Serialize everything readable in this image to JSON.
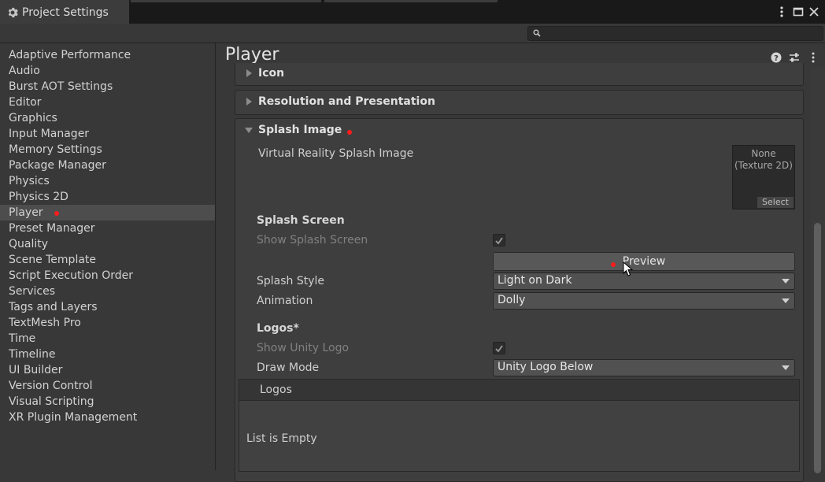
{
  "window": {
    "title": "Project Settings"
  },
  "sidebar": {
    "items": [
      {
        "label": "Adaptive Performance"
      },
      {
        "label": "Audio"
      },
      {
        "label": "Burst AOT Settings"
      },
      {
        "label": "Editor"
      },
      {
        "label": "Graphics"
      },
      {
        "label": "Input Manager"
      },
      {
        "label": "Memory Settings"
      },
      {
        "label": "Package Manager"
      },
      {
        "label": "Physics"
      },
      {
        "label": "Physics 2D"
      },
      {
        "label": "Player"
      },
      {
        "label": "Preset Manager"
      },
      {
        "label": "Quality"
      },
      {
        "label": "Scene Template"
      },
      {
        "label": "Script Execution Order"
      },
      {
        "label": "Services"
      },
      {
        "label": "Tags and Layers"
      },
      {
        "label": "TextMesh Pro"
      },
      {
        "label": "Time"
      },
      {
        "label": "Timeline"
      },
      {
        "label": "UI Builder"
      },
      {
        "label": "Version Control"
      },
      {
        "label": "Visual Scripting"
      },
      {
        "label": "XR Plugin Management"
      }
    ],
    "selected": "Player"
  },
  "main": {
    "title": "Player",
    "sections": {
      "icon": "Icon",
      "resolution": "Resolution and Presentation",
      "splash": "Splash Image"
    },
    "vr_splash_label": "Virtual Reality Splash Image",
    "texture_slot": {
      "line1": "None",
      "line2": "(Texture 2D)",
      "select": "Select"
    },
    "splash_screen_header": "Splash Screen",
    "show_splash_label": "Show Splash Screen",
    "show_splash_checked": true,
    "preview_label": "Preview",
    "splash_style_label": "Splash Style",
    "splash_style_value": "Light on Dark",
    "animation_label": "Animation",
    "animation_value": "Dolly",
    "logos_header": "Logos*",
    "show_unity_logo_label": "Show Unity Logo",
    "show_unity_logo_checked": true,
    "draw_mode_label": "Draw Mode",
    "draw_mode_value": "Unity Logo Below",
    "logos_list_title": "Logos",
    "logos_list_empty": "List is Empty"
  },
  "colors": {
    "background": "#383838",
    "titlebar": "#191919",
    "selected_item": "#4d4d4d",
    "marker_dot": "#ff1c1c"
  }
}
